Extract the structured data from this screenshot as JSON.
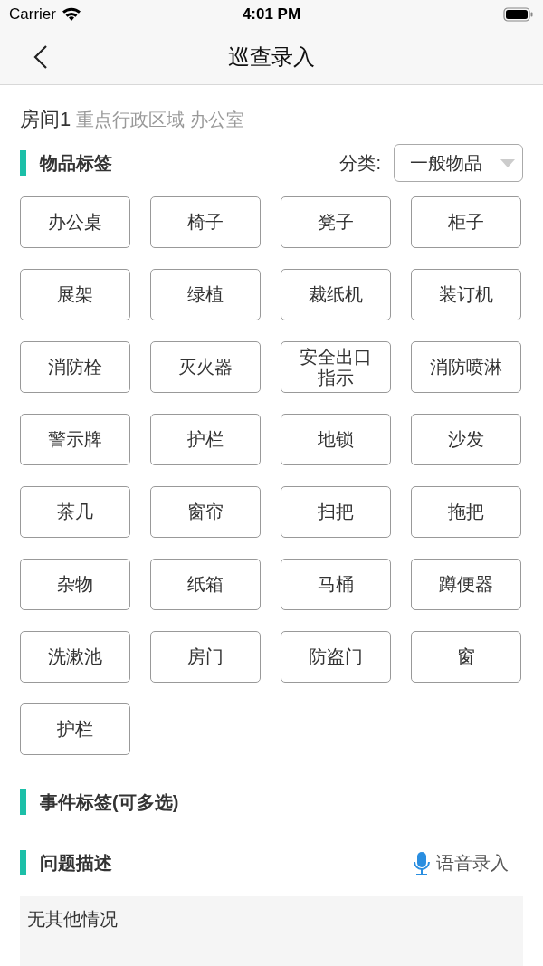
{
  "status_bar": {
    "carrier": "Carrier",
    "time": "4:01 PM"
  },
  "nav": {
    "title": "巡查录入"
  },
  "room": {
    "name": "房间1",
    "location": "重点行政区域 办公室"
  },
  "items_section": {
    "title": "物品标签",
    "category_label": "分类:",
    "category_value": "一般物品",
    "tags": [
      {
        "label": "办公桌"
      },
      {
        "label": "椅子"
      },
      {
        "label": "凳子"
      },
      {
        "label": "柜子"
      },
      {
        "label": "展架"
      },
      {
        "label": "绿植"
      },
      {
        "label": "裁纸机"
      },
      {
        "label": "装订机"
      },
      {
        "label": "消防栓"
      },
      {
        "label": "灭火器"
      },
      {
        "label": "安全出口指示"
      },
      {
        "label": "消防喷淋"
      },
      {
        "label": "警示牌"
      },
      {
        "label": "护栏"
      },
      {
        "label": "地锁"
      },
      {
        "label": "沙发"
      },
      {
        "label": "茶几"
      },
      {
        "label": "窗帘"
      },
      {
        "label": "扫把"
      },
      {
        "label": "拖把"
      },
      {
        "label": "杂物"
      },
      {
        "label": "纸箱"
      },
      {
        "label": "马桶"
      },
      {
        "label": "蹲便器"
      },
      {
        "label": "洗漱池"
      },
      {
        "label": "房门"
      },
      {
        "label": "防盗门"
      },
      {
        "label": "窗"
      },
      {
        "label": "护栏"
      }
    ]
  },
  "events_section": {
    "title": "事件标签(可多选)"
  },
  "description_section": {
    "title": "问题描述",
    "voice_button": "语音录入",
    "value": "无其他情况"
  }
}
